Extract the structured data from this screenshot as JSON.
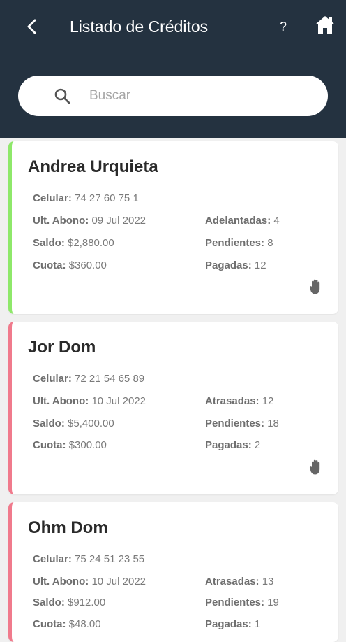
{
  "header": {
    "title": "Listado de Créditos",
    "help_label": "?"
  },
  "search": {
    "placeholder": "Buscar",
    "value": ""
  },
  "colors": {
    "header_bg": "#243240",
    "on_time_accent": "#8ee86a",
    "late_accent": "#f07a8c"
  },
  "credits": [
    {
      "name": "Andrea Urquieta",
      "status": "on_time",
      "phone_label": "Celular:",
      "phone": "74 27 60 75 1",
      "last_payment_label": "Ult. Abono:",
      "last_payment": "09 Jul 2022",
      "balance_label": "Saldo:",
      "balance": "$2,880.00",
      "installment_label": "Cuota:",
      "installment": "$360.00",
      "advance_label": "Adelantadas:",
      "advance": "4",
      "pending_label": "Pendientes:",
      "pending": "8",
      "paid_label": "Pagadas:",
      "paid": "12"
    },
    {
      "name": "Jor Dom",
      "status": "late",
      "phone_label": "Celular:",
      "phone": "72 21 54 65 89",
      "last_payment_label": "Ult. Abono:",
      "last_payment": "10 Jul 2022",
      "balance_label": "Saldo:",
      "balance": "$5,400.00",
      "installment_label": "Cuota:",
      "installment": "$300.00",
      "advance_label": "Atrasadas:",
      "advance": "12",
      "pending_label": "Pendientes:",
      "pending": "18",
      "paid_label": "Pagadas:",
      "paid": "2"
    },
    {
      "name": "Ohm Dom",
      "status": "late",
      "phone_label": "Celular:",
      "phone": "75 24 51 23 55",
      "last_payment_label": "Ult. Abono:",
      "last_payment": "10 Jul 2022",
      "balance_label": "Saldo:",
      "balance": "$912.00",
      "installment_label": "Cuota:",
      "installment": "$48.00",
      "advance_label": "Atrasadas:",
      "advance": "13",
      "pending_label": "Pendientes:",
      "pending": "19",
      "paid_label": "Pagadas:",
      "paid": "1"
    }
  ]
}
